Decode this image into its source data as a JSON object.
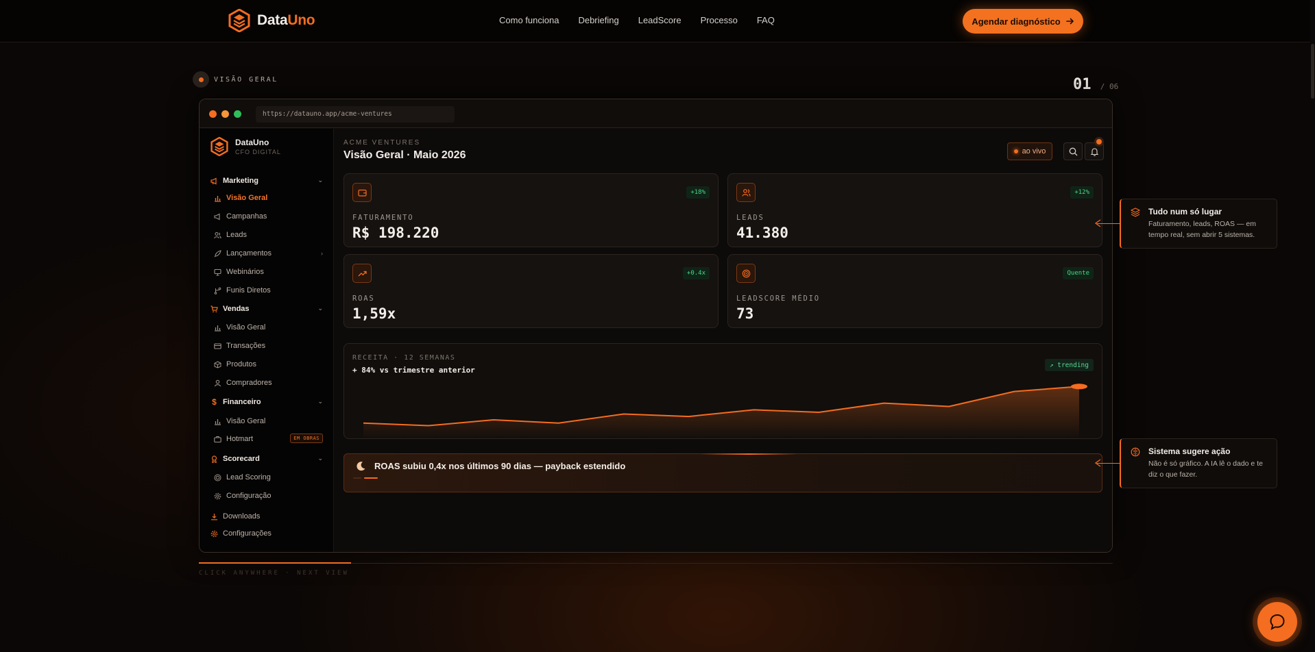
{
  "topnav": {
    "brand_prefix": "Data",
    "brand_suffix": "Uno",
    "links": [
      "Como funciona",
      "Debriefing",
      "LeadScore",
      "Processo",
      "FAQ"
    ],
    "cta_label": "Agendar diagnóstico"
  },
  "section": {
    "label": "VISÃO GERAL",
    "counter_current": "01",
    "counter_total": "/ 06"
  },
  "browser": {
    "url": "https://datauno.app/acme-ventures"
  },
  "sidebar": {
    "brand": "DataUno",
    "brand_sub": "CFO DIGITAL",
    "groups": [
      {
        "label": "Marketing",
        "items": [
          "Visão Geral",
          "Campanhas",
          "Leads",
          "Lançamentos",
          "Webinários",
          "Funis Diretos"
        ]
      },
      {
        "label": "Vendas",
        "items": [
          "Visão Geral",
          "Transações",
          "Produtos",
          "Compradores"
        ]
      },
      {
        "label": "Financeiro",
        "items": [
          "Visão Geral",
          "Hotmart"
        ],
        "badge": "EM OBRAS"
      },
      {
        "label": "Scorecard",
        "items": [
          "Lead Scoring",
          "Configuração"
        ]
      }
    ],
    "footer_items": [
      "Downloads",
      "Configurações"
    ]
  },
  "main": {
    "company": "ACME VENTURES",
    "title": "Visão Geral · Maio 2026",
    "live_label": "ao vivo",
    "kpis": [
      {
        "label": "FATURAMENTO",
        "value": "R$ 198.220",
        "delta": "+18%"
      },
      {
        "label": "LEADS",
        "value": "41.380",
        "delta": "+12%"
      },
      {
        "label": "ROAS",
        "value": "1,59x",
        "delta": "+0.4x"
      },
      {
        "label": "LEADSCORE MÉDIO",
        "value": "73",
        "delta": "Quente"
      }
    ],
    "chart": {
      "label": "RECEITA · 12 SEMANAS",
      "subtitle": "+ 84% vs trimestre anterior",
      "badge": "↗ trending"
    },
    "alert": {
      "text": "ROAS subiu 0,4x nos últimos 90 dias — payback estendido",
      "progress": 0.25
    }
  },
  "callouts": [
    {
      "title": "Tudo num só lugar",
      "body": "Faturamento, leads, ROAS — em tempo real, sem abrir 5 sistemas."
    },
    {
      "title": "Sistema sugere ação",
      "body": "Não é só gráfico. A IA lê o dado e te diz o que fazer."
    }
  ],
  "footer_hint": "CLICK ANYWHERE · NEXT VIEW",
  "chart_data": {
    "type": "area",
    "title": "",
    "xlabel": "",
    "ylabel": "",
    "x": [
      1,
      2,
      3,
      4,
      5,
      6,
      7,
      8,
      9,
      10,
      11,
      12
    ],
    "values": [
      5,
      3.5,
      7,
      5,
      10.5,
      9,
      13,
      11.5,
      17,
      15,
      24,
      27
    ],
    "ylim": [
      0,
      30
    ],
    "grid": false,
    "legend": "none",
    "colors": {
      "line": "#f46d20",
      "fill": "#f46d20"
    }
  },
  "colors": {
    "accent": "#f46d20",
    "positive": "#4cd58a",
    "background": "#0a0706"
  }
}
